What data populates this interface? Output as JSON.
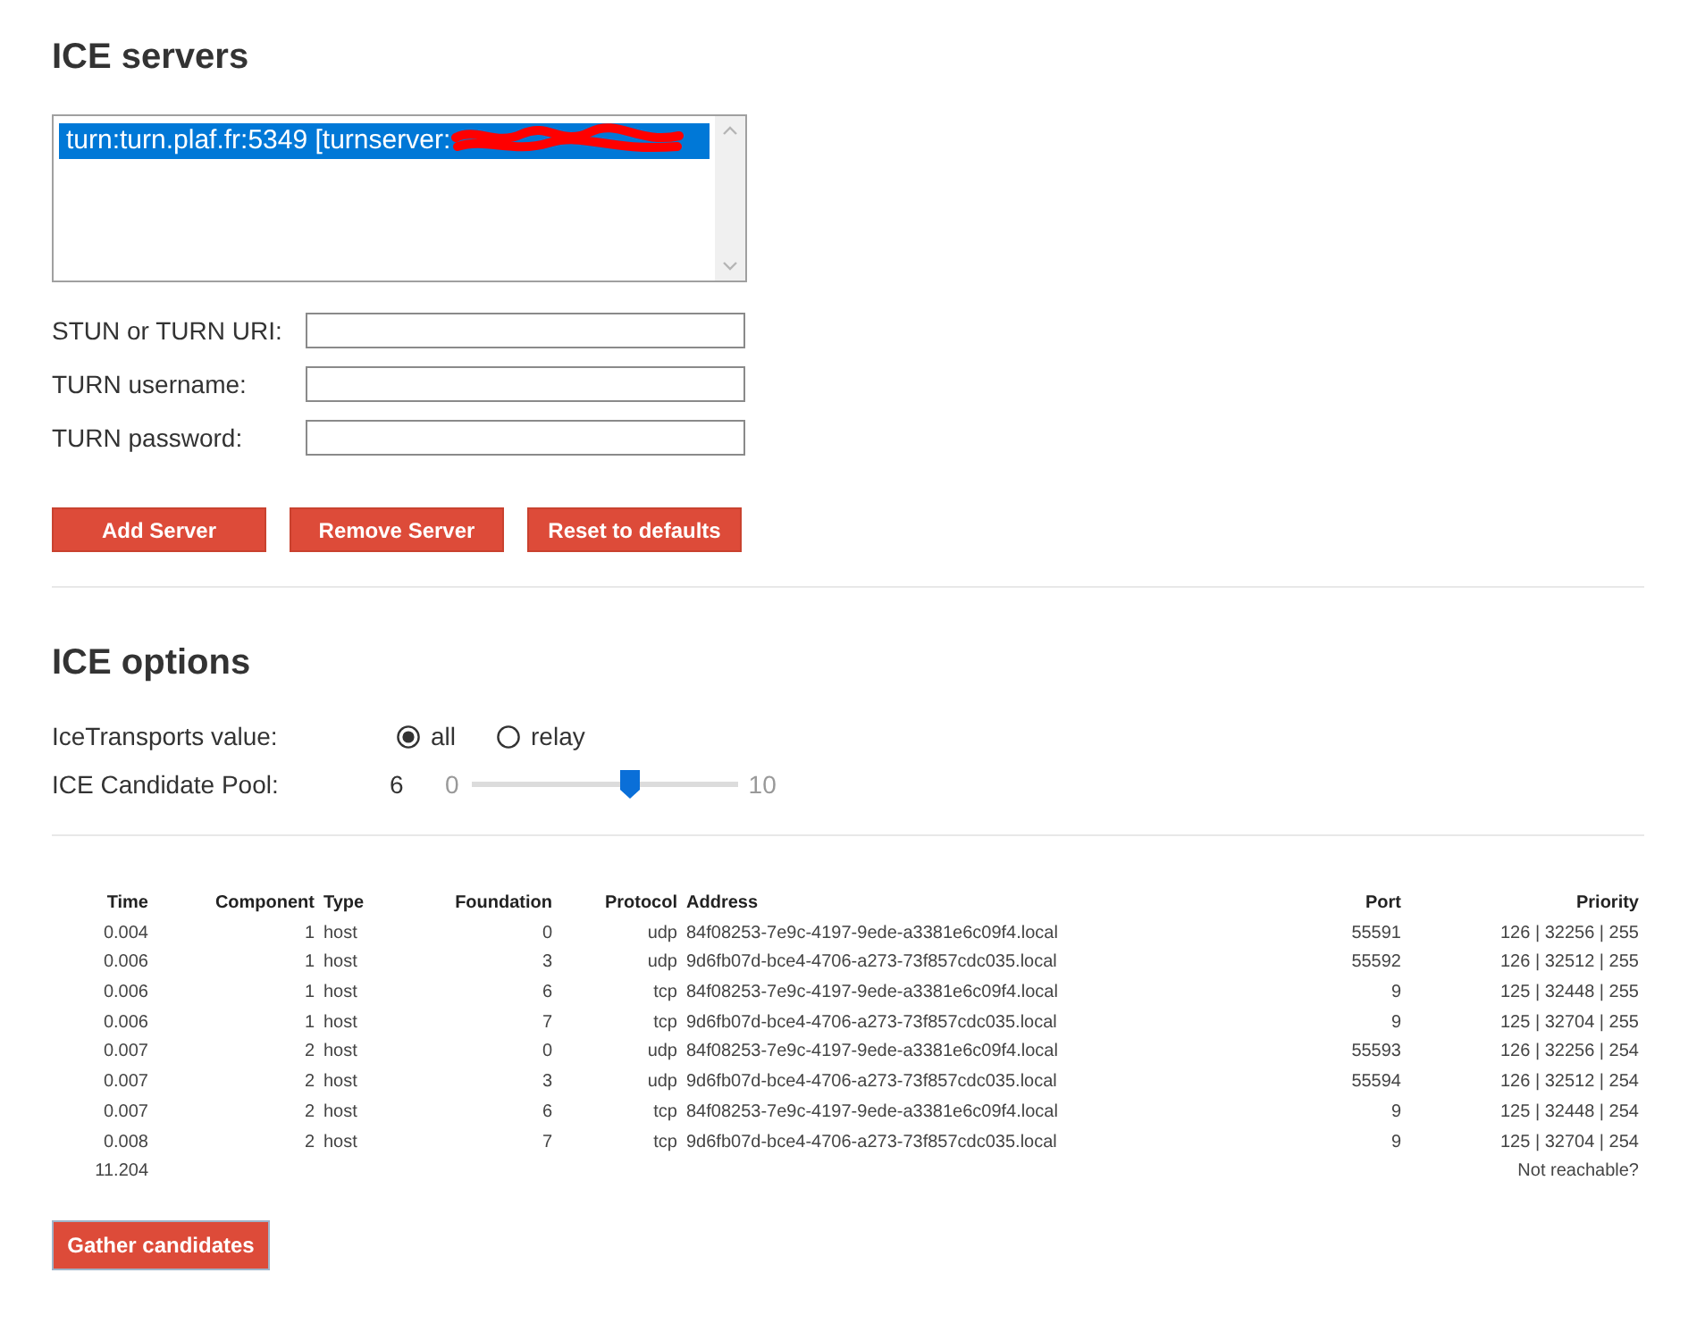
{
  "ice_servers": {
    "title": "ICE servers",
    "server_list": [
      {
        "text": "turn:turn.plaf.fr:5349 [turnserver:",
        "selected": true,
        "redacted": true
      }
    ],
    "fields": [
      {
        "label": "STUN or TURN URI:"
      },
      {
        "label": "TURN username:"
      },
      {
        "label": "TURN password:"
      }
    ],
    "buttons": [
      "Add Server",
      "Remove Server",
      "Reset to defaults"
    ]
  },
  "ice_options": {
    "title": "ICE options",
    "transports": {
      "label": "IceTransports value:",
      "options": [
        {
          "label": "all",
          "selected": true
        },
        {
          "label": "relay",
          "selected": false
        }
      ]
    },
    "pool": {
      "label": "ICE Candidate Pool:",
      "value": "6",
      "min": "0",
      "max": "10",
      "level": 0.6
    }
  },
  "candidates": {
    "columns": [
      "Time",
      "Component",
      "Type",
      "Foundation",
      "Protocol",
      "Address",
      "Port",
      "Priority"
    ],
    "rows": [
      [
        "0.004",
        "1",
        "host",
        "0",
        "udp",
        "84f08253-7e9c-4197-9ede-a3381e6c09f4.local",
        "55591",
        "126 | 32256 | 255"
      ],
      [
        "0.006",
        "1",
        "host",
        "3",
        "udp",
        "9d6fb07d-bce4-4706-a273-73f857cdc035.local",
        "55592",
        "126 | 32512 | 255"
      ],
      [
        "0.006",
        "1",
        "host",
        "6",
        "tcp",
        "84f08253-7e9c-4197-9ede-a3381e6c09f4.local",
        "9",
        "125 | 32448 | 255"
      ],
      [
        "0.006",
        "1",
        "host",
        "7",
        "tcp",
        "9d6fb07d-bce4-4706-a273-73f857cdc035.local",
        "9",
        "125 | 32704 | 255"
      ],
      [
        "0.007",
        "2",
        "host",
        "0",
        "udp",
        "84f08253-7e9c-4197-9ede-a3381e6c09f4.local",
        "55593",
        "126 | 32256 | 254"
      ],
      [
        "0.007",
        "2",
        "host",
        "3",
        "udp",
        "9d6fb07d-bce4-4706-a273-73f857cdc035.local",
        "55594",
        "126 | 32512 | 254"
      ],
      [
        "0.007",
        "2",
        "host",
        "6",
        "tcp",
        "84f08253-7e9c-4197-9ede-a3381e6c09f4.local",
        "9",
        "125 | 32448 | 254"
      ],
      [
        "0.008",
        "2",
        "host",
        "7",
        "tcp",
        "9d6fb07d-bce4-4706-a273-73f857cdc035.local",
        "9",
        "125 | 32704 | 254"
      ]
    ],
    "footer": {
      "time": "11.204",
      "status": "Not reachable?"
    }
  },
  "gather_button": "Gather candidates"
}
